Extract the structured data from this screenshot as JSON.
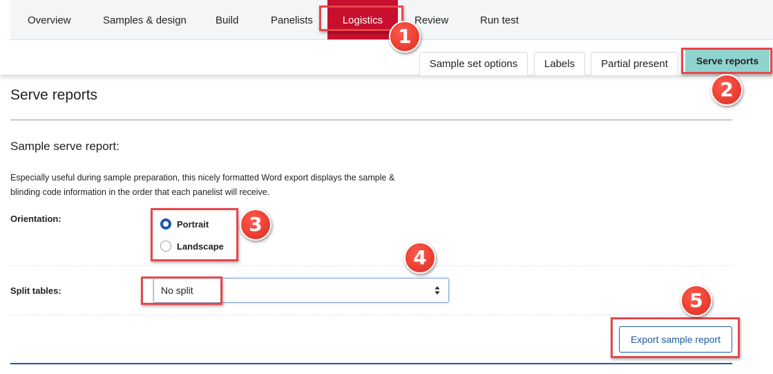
{
  "topnav": {
    "items": [
      {
        "label": "Overview"
      },
      {
        "label": "Samples & design"
      },
      {
        "label": "Build"
      },
      {
        "label": "Panelists"
      },
      {
        "label": "Logistics",
        "active": true
      },
      {
        "label": "Review"
      },
      {
        "label": "Run test"
      }
    ]
  },
  "subtabs": [
    {
      "label": "Sample set options"
    },
    {
      "label": "Labels"
    },
    {
      "label": "Partial present"
    },
    {
      "label": "Serve reports",
      "active": true
    }
  ],
  "page": {
    "title": "Serve reports",
    "section_title": "Sample serve report:",
    "description": "Especially useful during sample preparation, this nicely formatted Word export displays the sample & blinding code information in the order that each panelist will receive."
  },
  "orientation": {
    "label": "Orientation:",
    "options": [
      {
        "label": "Portrait",
        "checked": true
      },
      {
        "label": "Landscape",
        "checked": false
      }
    ]
  },
  "split_tables": {
    "label": "Split tables:",
    "selected": "No split"
  },
  "export_button": {
    "label": "Export sample report"
  },
  "annotations": [
    "1",
    "2",
    "3",
    "4",
    "5"
  ],
  "colors": {
    "brand_red": "#c8102e",
    "active_subtab": "#8fd3cf",
    "primary_blue": "#1b5aa6",
    "annotation_red": "#e8464a"
  }
}
